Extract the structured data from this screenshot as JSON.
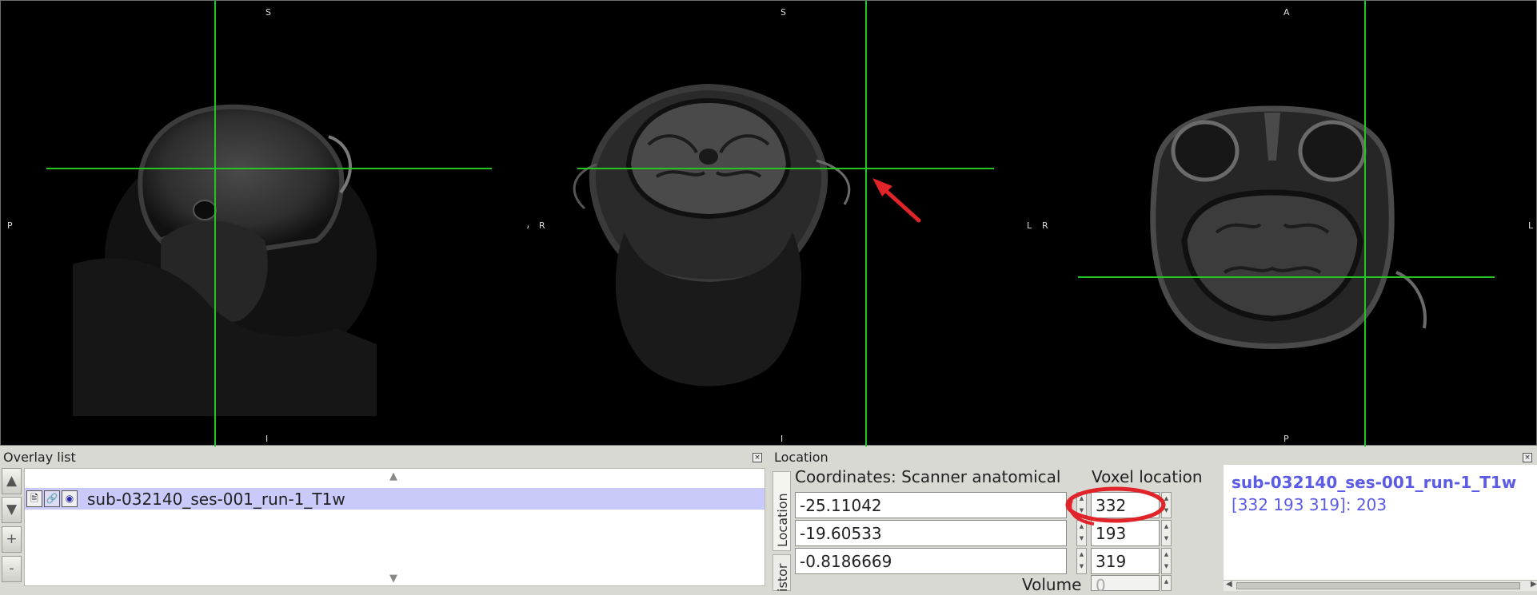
{
  "viewer": {
    "sagittal": {
      "top": "S",
      "bottom": "I",
      "left": "P",
      "right": "A"
    },
    "coronal": {
      "top": "S",
      "bottom": "I",
      "left": "R",
      "right": "L"
    },
    "axial": {
      "top": "A",
      "bottom": "P",
      "left": "R",
      "right": "L"
    },
    "crosshair_color": "#22c522",
    "annotation_color": "#e0242a"
  },
  "overlay_list": {
    "title": "Overlay list",
    "buttons": {
      "up": "▲",
      "down": "▼",
      "add": "+",
      "remove": "-"
    },
    "scroll_up": "▲",
    "scroll_down": "▼",
    "items": [
      {
        "name": "sub-032140_ses-001_run-1_T1w",
        "icons": [
          "file-icon",
          "link-icon",
          "eye-icon"
        ],
        "selected": true
      }
    ]
  },
  "location": {
    "title": "Location",
    "tabs": [
      "Location",
      "istor"
    ],
    "coord_label": "Coordinates: Scanner anatomical",
    "voxel_label": "Voxel location",
    "coordinates": [
      "-25.11042",
      "-19.60533",
      "-0.8186669"
    ],
    "voxels": [
      "332",
      "193",
      "319"
    ],
    "volume_label": "Volume",
    "volume_value": "0",
    "info": {
      "name": "sub-032140_ses-001_run-1_T1w",
      "value": "[332 193 319]: 203"
    }
  }
}
